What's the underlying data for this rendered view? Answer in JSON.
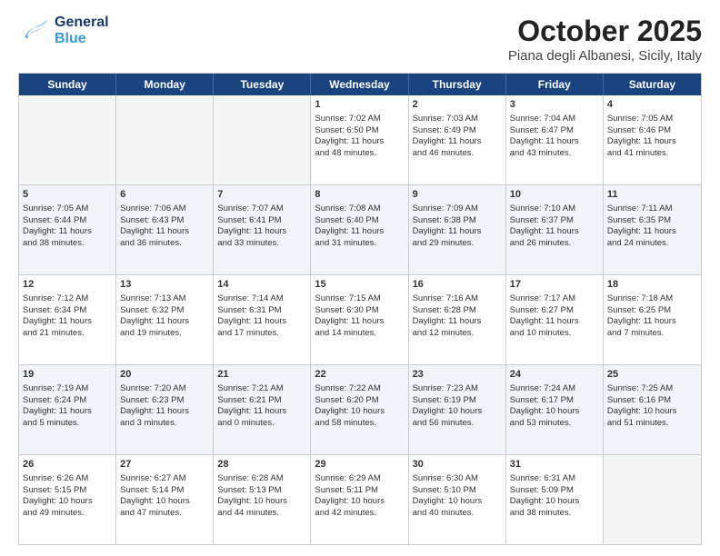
{
  "header": {
    "logo": {
      "general": "General",
      "blue": "Blue"
    },
    "title": "October 2025",
    "subtitle": "Piana degli Albanesi, Sicily, Italy"
  },
  "dayHeaders": [
    "Sunday",
    "Monday",
    "Tuesday",
    "Wednesday",
    "Thursday",
    "Friday",
    "Saturday"
  ],
  "weeks": [
    [
      {
        "num": "",
        "lines": []
      },
      {
        "num": "",
        "lines": []
      },
      {
        "num": "",
        "lines": []
      },
      {
        "num": "1",
        "lines": [
          "Sunrise: 7:02 AM",
          "Sunset: 6:50 PM",
          "Daylight: 11 hours",
          "and 48 minutes."
        ]
      },
      {
        "num": "2",
        "lines": [
          "Sunrise: 7:03 AM",
          "Sunset: 6:49 PM",
          "Daylight: 11 hours",
          "and 46 minutes."
        ]
      },
      {
        "num": "3",
        "lines": [
          "Sunrise: 7:04 AM",
          "Sunset: 6:47 PM",
          "Daylight: 11 hours",
          "and 43 minutes."
        ]
      },
      {
        "num": "4",
        "lines": [
          "Sunrise: 7:05 AM",
          "Sunset: 6:46 PM",
          "Daylight: 11 hours",
          "and 41 minutes."
        ]
      }
    ],
    [
      {
        "num": "5",
        "lines": [
          "Sunrise: 7:05 AM",
          "Sunset: 6:44 PM",
          "Daylight: 11 hours",
          "and 38 minutes."
        ]
      },
      {
        "num": "6",
        "lines": [
          "Sunrise: 7:06 AM",
          "Sunset: 6:43 PM",
          "Daylight: 11 hours",
          "and 36 minutes."
        ]
      },
      {
        "num": "7",
        "lines": [
          "Sunrise: 7:07 AM",
          "Sunset: 6:41 PM",
          "Daylight: 11 hours",
          "and 33 minutes."
        ]
      },
      {
        "num": "8",
        "lines": [
          "Sunrise: 7:08 AM",
          "Sunset: 6:40 PM",
          "Daylight: 11 hours",
          "and 31 minutes."
        ]
      },
      {
        "num": "9",
        "lines": [
          "Sunrise: 7:09 AM",
          "Sunset: 6:38 PM",
          "Daylight: 11 hours",
          "and 29 minutes."
        ]
      },
      {
        "num": "10",
        "lines": [
          "Sunrise: 7:10 AM",
          "Sunset: 6:37 PM",
          "Daylight: 11 hours",
          "and 26 minutes."
        ]
      },
      {
        "num": "11",
        "lines": [
          "Sunrise: 7:11 AM",
          "Sunset: 6:35 PM",
          "Daylight: 11 hours",
          "and 24 minutes."
        ]
      }
    ],
    [
      {
        "num": "12",
        "lines": [
          "Sunrise: 7:12 AM",
          "Sunset: 6:34 PM",
          "Daylight: 11 hours",
          "and 21 minutes."
        ]
      },
      {
        "num": "13",
        "lines": [
          "Sunrise: 7:13 AM",
          "Sunset: 6:32 PM",
          "Daylight: 11 hours",
          "and 19 minutes."
        ]
      },
      {
        "num": "14",
        "lines": [
          "Sunrise: 7:14 AM",
          "Sunset: 6:31 PM",
          "Daylight: 11 hours",
          "and 17 minutes."
        ]
      },
      {
        "num": "15",
        "lines": [
          "Sunrise: 7:15 AM",
          "Sunset: 6:30 PM",
          "Daylight: 11 hours",
          "and 14 minutes."
        ]
      },
      {
        "num": "16",
        "lines": [
          "Sunrise: 7:16 AM",
          "Sunset: 6:28 PM",
          "Daylight: 11 hours",
          "and 12 minutes."
        ]
      },
      {
        "num": "17",
        "lines": [
          "Sunrise: 7:17 AM",
          "Sunset: 6:27 PM",
          "Daylight: 11 hours",
          "and 10 minutes."
        ]
      },
      {
        "num": "18",
        "lines": [
          "Sunrise: 7:18 AM",
          "Sunset: 6:25 PM",
          "Daylight: 11 hours",
          "and 7 minutes."
        ]
      }
    ],
    [
      {
        "num": "19",
        "lines": [
          "Sunrise: 7:19 AM",
          "Sunset: 6:24 PM",
          "Daylight: 11 hours",
          "and 5 minutes."
        ]
      },
      {
        "num": "20",
        "lines": [
          "Sunrise: 7:20 AM",
          "Sunset: 6:23 PM",
          "Daylight: 11 hours",
          "and 3 minutes."
        ]
      },
      {
        "num": "21",
        "lines": [
          "Sunrise: 7:21 AM",
          "Sunset: 6:21 PM",
          "Daylight: 11 hours",
          "and 0 minutes."
        ]
      },
      {
        "num": "22",
        "lines": [
          "Sunrise: 7:22 AM",
          "Sunset: 6:20 PM",
          "Daylight: 10 hours",
          "and 58 minutes."
        ]
      },
      {
        "num": "23",
        "lines": [
          "Sunrise: 7:23 AM",
          "Sunset: 6:19 PM",
          "Daylight: 10 hours",
          "and 56 minutes."
        ]
      },
      {
        "num": "24",
        "lines": [
          "Sunrise: 7:24 AM",
          "Sunset: 6:17 PM",
          "Daylight: 10 hours",
          "and 53 minutes."
        ]
      },
      {
        "num": "25",
        "lines": [
          "Sunrise: 7:25 AM",
          "Sunset: 6:16 PM",
          "Daylight: 10 hours",
          "and 51 minutes."
        ]
      }
    ],
    [
      {
        "num": "26",
        "lines": [
          "Sunrise: 6:26 AM",
          "Sunset: 5:15 PM",
          "Daylight: 10 hours",
          "and 49 minutes."
        ]
      },
      {
        "num": "27",
        "lines": [
          "Sunrise: 6:27 AM",
          "Sunset: 5:14 PM",
          "Daylight: 10 hours",
          "and 47 minutes."
        ]
      },
      {
        "num": "28",
        "lines": [
          "Sunrise: 6:28 AM",
          "Sunset: 5:13 PM",
          "Daylight: 10 hours",
          "and 44 minutes."
        ]
      },
      {
        "num": "29",
        "lines": [
          "Sunrise: 6:29 AM",
          "Sunset: 5:11 PM",
          "Daylight: 10 hours",
          "and 42 minutes."
        ]
      },
      {
        "num": "30",
        "lines": [
          "Sunrise: 6:30 AM",
          "Sunset: 5:10 PM",
          "Daylight: 10 hours",
          "and 40 minutes."
        ]
      },
      {
        "num": "31",
        "lines": [
          "Sunrise: 6:31 AM",
          "Sunset: 5:09 PM",
          "Daylight: 10 hours",
          "and 38 minutes."
        ]
      },
      {
        "num": "",
        "lines": []
      }
    ]
  ]
}
